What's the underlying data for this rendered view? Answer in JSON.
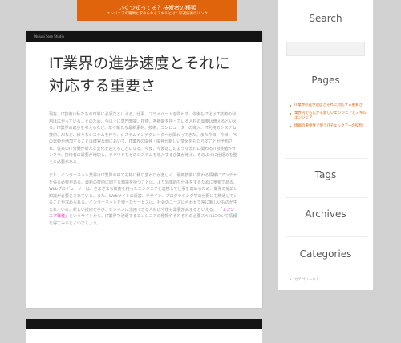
{
  "site": {
    "title": "いくつ知ってる？技術者の種類",
    "tagline": "エンジニアの種類と求められるスキルとは？知識技術のリンク"
  },
  "post": {
    "topbar_label": "Nojuni Sore Studio",
    "title": "IT業界の進歩速度とそれに対応する重要さ",
    "paragraph1": "現在、IT技術は私たちの日常に必須だといえる。仕事、プライベートを問わず、今後もIT化はIT技術の利用は広がっている。そのため、今以上に専門知識、技術、各機能を持っている人材の需要は増えるといえる。IT業界の進歩を考えるなど、年々新たな最新素材、技術、コンピューターの導入、IT利用のシステム技術、AIなど、様々なシステムを作り、システムインテグレーターが関わってきた。また今日、今日、PCの需要が増加することは確実な面において、IT業界の開発・開発が新しい変化をもたらすことが予想され、従来のIT分野が新たな変化を迎えることになる。今後、今後はこのような流れに関わるIT技術者やインフラ、技術者の需要が増加し、クラウドなどのシステムを導入する企業が増え、そのように仕組みを整える必要がある。",
    "paragraph2": "また、インターネット業界はIT業界の中でも特に移り変わりが激しく、最新技術に関わる情報にアンテナを張る必要がある。最新の技術に関する知識を持つことは、より効率的な仕事をするために重要である。Webプロデューサーは、さまざまな技術を持ったエンジニアと連携して仕事を進めるため、開発の幅広い知識が必要とされている。また、Webサイトの運営、デザイン、プログラミング等の分野にも精通していることが求められる。インターネットを使ったサービスは、社会のニーズに合わせて常に新しいものが生まれている。新しい技術を学び、ビジネスに活用できる人材は今後も需要が高まるといえる。",
    "highlight": "「エンジニア職種」",
    "paragraph2_end": "というサイトから、IT業界で活躍するエンジニアの種類やそれぞれの必要スキルについて情報を得てみるとよいでしょう。"
  },
  "sidebar": {
    "search_title": "Search",
    "search_placeholder": "",
    "pages_title": "Pages",
    "pages": [
      "IT業界の進歩速度とそれに対応する重要さ",
      "業界内でも広がる新しいエンジニアとスキルエンジニア",
      "情報の重要性で使うITチェックアーの役割"
    ],
    "tags_title": "Tags",
    "archives_title": "Archives",
    "categories_title": "Categories",
    "categories": [
      "カテゴリーなし"
    ]
  },
  "colors": {
    "accent": "#e0640c",
    "highlight": "#e63ec0"
  }
}
